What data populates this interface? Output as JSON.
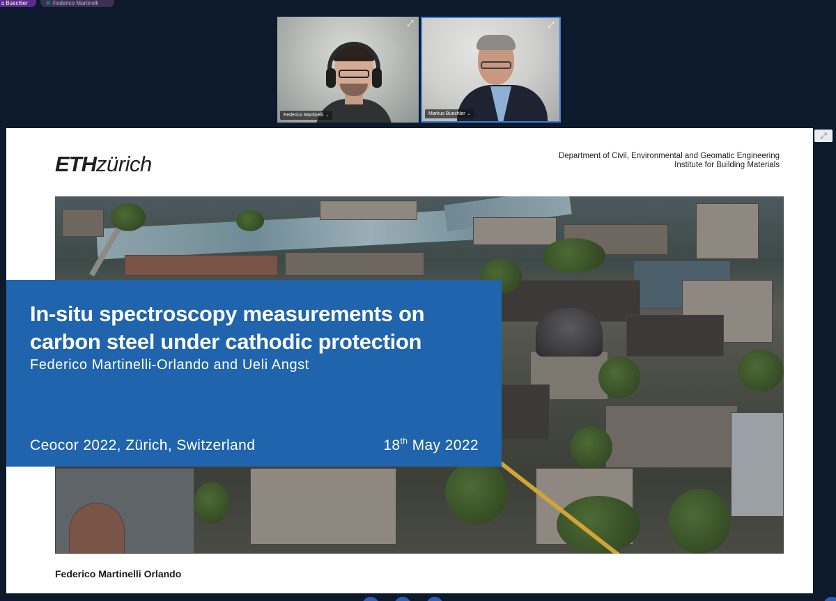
{
  "speaker_chips": [
    "s Buechler",
    "Federico Martinelli"
  ],
  "participants": [
    {
      "name": "Federico Martinelli",
      "active": false
    },
    {
      "name": "Markus Buechler",
      "active": true
    }
  ],
  "expand_glyph": "⤢",
  "slide": {
    "logo_bold": "ETH",
    "logo_light": "zürich",
    "department_line1": "Department of Civil, Environmental and Geomatic Engineering",
    "department_line2": "Institute for Building Materials",
    "title": "In-situ spectroscopy measurements on carbon steel under cathodic protection",
    "authors": "Federico Martinelli-Orlando and Ueli Angst",
    "event": "Ceocor 2022, Zürich, Switzerland",
    "date_day": "18",
    "date_suffix": "th",
    "date_rest": " May 2022",
    "footer_name": "Federico Martinelli Orlando"
  },
  "colors": {
    "background": "#0c1a2b",
    "title_box": "#1f64ac",
    "active_border": "#3d7de0",
    "speaker_chip": "#5b2b8a"
  }
}
